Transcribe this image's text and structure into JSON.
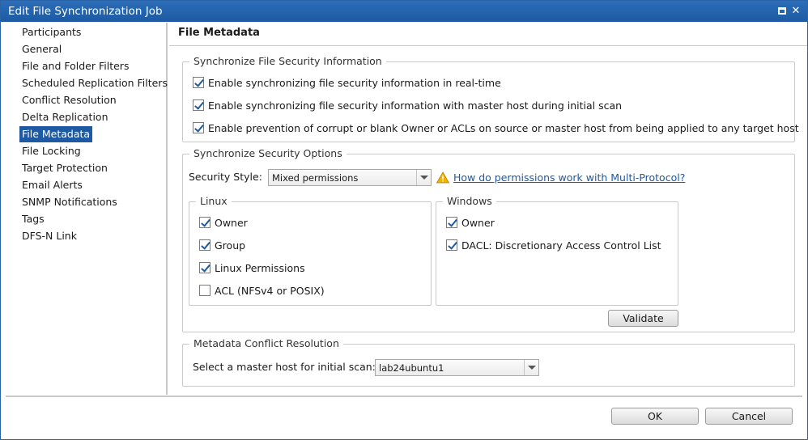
{
  "window": {
    "title": "Edit File Synchronization Job"
  },
  "sidebar": {
    "items": [
      {
        "label": "Participants"
      },
      {
        "label": "General"
      },
      {
        "label": "File and Folder Filters"
      },
      {
        "label": "Scheduled Replication Filters"
      },
      {
        "label": "Conflict Resolution"
      },
      {
        "label": "Delta Replication"
      },
      {
        "label": "File Metadata",
        "selected": true
      },
      {
        "label": "File Locking"
      },
      {
        "label": "Target Protection"
      },
      {
        "label": "Email Alerts"
      },
      {
        "label": "SNMP Notifications"
      },
      {
        "label": "Tags"
      },
      {
        "label": "DFS-N Link"
      }
    ]
  },
  "main": {
    "title": "File Metadata",
    "security_info": {
      "legend": "Synchronize File Security Information",
      "options": [
        {
          "label": "Enable synchronizing file security information in real-time",
          "checked": true
        },
        {
          "label": "Enable synchronizing file security information with master host during initial scan",
          "checked": true
        },
        {
          "label": "Enable prevention of corrupt or blank Owner or ACLs on source or master host from being applied to any target host",
          "checked": true
        }
      ]
    },
    "security_options": {
      "legend": "Synchronize Security Options",
      "style_label": "Security Style:",
      "style_value": "Mixed permissions",
      "help_link": "How do permissions work with Multi-Protocol?",
      "linux": {
        "legend": "Linux",
        "options": [
          {
            "label": "Owner",
            "checked": true
          },
          {
            "label": "Group",
            "checked": true
          },
          {
            "label": "Linux Permissions",
            "checked": true
          },
          {
            "label": "ACL (NFSv4 or POSIX)",
            "checked": false
          }
        ]
      },
      "windows": {
        "legend": "Windows",
        "options": [
          {
            "label": "Owner",
            "checked": true
          },
          {
            "label": "DACL: Discretionary Access Control List",
            "checked": true
          }
        ]
      },
      "validate_label": "Validate"
    },
    "conflict": {
      "legend": "Metadata Conflict Resolution",
      "master_label": "Select a master host for initial scan:",
      "master_value": "lab24ubuntu1"
    }
  },
  "footer": {
    "ok_label": "OK",
    "cancel_label": "Cancel"
  },
  "colors": {
    "accent": "#1d5aa3",
    "titlebar": "#1f5fa8",
    "link": "#1d5aa3",
    "warning": "#f0b400"
  }
}
